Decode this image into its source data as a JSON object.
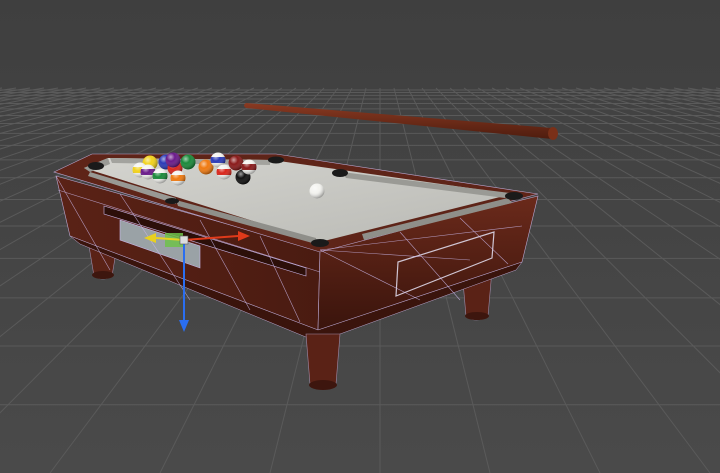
{
  "scene": {
    "background_color": "#474747",
    "sky_color": "#474747",
    "grid_color": "#5a5a5a",
    "grid_visible": true,
    "wireframe_overlay": true,
    "wireframe_color": "#c9b6e8"
  },
  "table": {
    "wood_color": "#5e2418",
    "wood_dark_color": "#3d160e",
    "felt_color": "#c9c9c4",
    "cushion_color": "#9a9a95",
    "leg_count": 4
  },
  "cue": {
    "color": "#6a2a16",
    "tip_color": "#8a3a22"
  },
  "balls": [
    {
      "name": "ball-1",
      "color": "#f2d21b",
      "stripe": false
    },
    {
      "name": "ball-2",
      "color": "#2a3ab8",
      "stripe": false
    },
    {
      "name": "ball-3",
      "color": "#d9261c",
      "stripe": false
    },
    {
      "name": "ball-4",
      "color": "#6a1a8a",
      "stripe": false
    },
    {
      "name": "ball-5",
      "color": "#f07a10",
      "stripe": false
    },
    {
      "name": "ball-6",
      "color": "#1a8a3a",
      "stripe": false
    },
    {
      "name": "ball-7",
      "color": "#8a1a1a",
      "stripe": false
    },
    {
      "name": "ball-8",
      "color": "#111111",
      "stripe": false
    },
    {
      "name": "ball-9",
      "color": "#f2d21b",
      "stripe": true
    },
    {
      "name": "ball-10",
      "color": "#2a3ab8",
      "stripe": true
    },
    {
      "name": "ball-11",
      "color": "#d9261c",
      "stripe": true
    },
    {
      "name": "ball-12",
      "color": "#6a1a8a",
      "stripe": true
    },
    {
      "name": "ball-13",
      "color": "#f07a10",
      "stripe": true
    },
    {
      "name": "ball-14",
      "color": "#1a8a3a",
      "stripe": true
    },
    {
      "name": "ball-15",
      "color": "#8a1a1a",
      "stripe": true
    },
    {
      "name": "cue-ball",
      "color": "#f4f4f0",
      "stripe": false
    }
  ],
  "gizmo": {
    "y_axis_color": "#2a6ef0",
    "x_axis_color": "#e03a1a",
    "z_axis_color": "#e8d020",
    "plane_color": "#6fc24a"
  }
}
